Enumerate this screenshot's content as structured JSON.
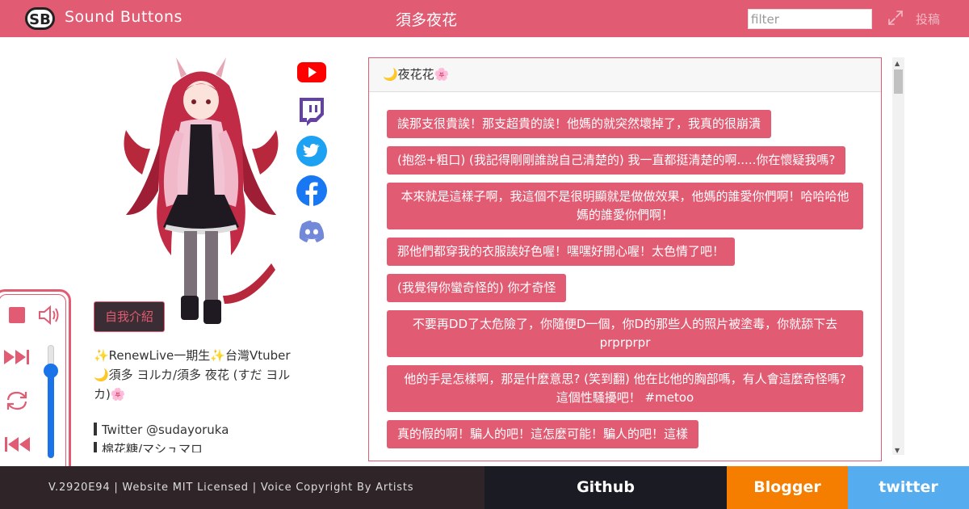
{
  "header": {
    "site_title": "Sound Buttons",
    "page_title": "須多夜花",
    "filter_placeholder": "filter",
    "post_label": "投稿",
    "colors": {
      "primary": "#e15b73"
    }
  },
  "social": [
    "youtube-icon",
    "twitch-icon",
    "twitter-icon",
    "facebook-icon",
    "discord-icon"
  ],
  "intro_button": "自我介紹",
  "profile": {
    "line1": "✨RenewLive一期生✨台灣Vtuber",
    "line2": "🌙須多 ヨルカ/須多 夜花 (すだ ヨル",
    "line3": "カ)🌸",
    "twitter": "Twitter @sudayoruka",
    "marshmallow": "棉花糖/マシュマロ"
  },
  "player": {
    "controls": [
      "stop-icon",
      "volume-icon",
      "next-icon",
      "repeat-icon",
      "previous-icon"
    ],
    "volume": 0.78
  },
  "sound_panel": {
    "header": "🌙夜花花🌸",
    "sounds": [
      "誒那支很貴誒！那支超貴的誒！他媽的就突然壞掉了，我真的很崩潰",
      "(抱怨+粗口) (我記得剛剛誰說自己清楚的) 我一直都挺清楚的啊.....你在懷疑我嗎?",
      "本來就是這樣子啊，我這個不是很明顯就是做做效果，他媽的誰愛你們啊！哈哈哈他媽的誰愛你們啊！",
      "那他們都穿我的衣服誒好色喔！嘿嘿好開心喔！太色情了吧！",
      "(我覺得你蠻奇怪的) 你才奇怪",
      "不要再DD了太危險了，你隨便D一個，你D的那些人的照片被塗毒，你就舔下去prprprpr",
      "他的手是怎樣啊，那是什麼意思? (笑到翻) 他在比他的胸部嗎，有人會這麼奇怪嗎? 這個性騷擾吧！ #metoo",
      "真的假的啊！騙人的吧！這怎麼可能！騙人的吧！這樣"
    ]
  },
  "footer": {
    "version": "V.2920E94 | Website MIT Licensed | Voice Copyright By Artists",
    "github": "Github",
    "blogger": "Blogger",
    "twitter": "twitter"
  }
}
